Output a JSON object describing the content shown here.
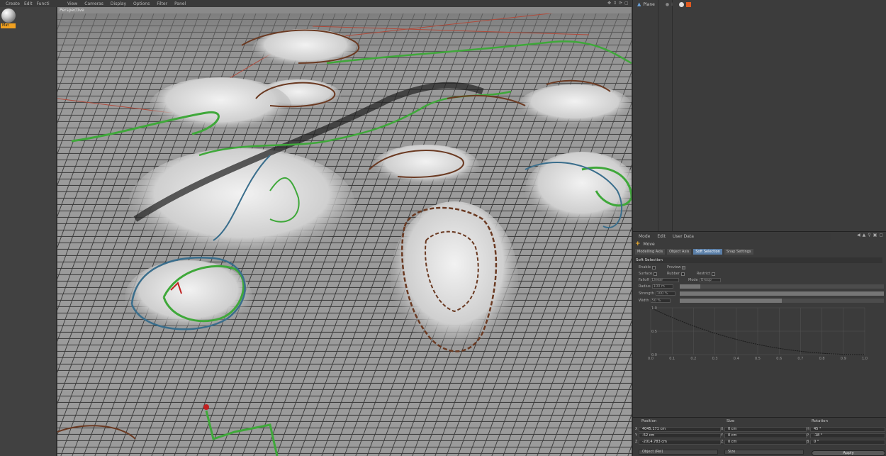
{
  "material_manager": {
    "menu": [
      "Create",
      "Edit",
      "Functi"
    ],
    "material_label": "Mat"
  },
  "viewport": {
    "menu": [
      "View",
      "Cameras",
      "Display",
      "Options",
      "Filter",
      "Panel"
    ],
    "camera_label": "Perspective"
  },
  "object_manager": {
    "object_name": "Plane"
  },
  "attribute_manager": {
    "menu": [
      "Mode",
      "Edit",
      "User Data"
    ],
    "tool_name": "Move",
    "tabs": [
      "Modelling Axis",
      "Object Axis",
      "Soft Selection",
      "Snap Settings"
    ],
    "active_tab": "Soft Selection",
    "section_title": "Soft Selection",
    "options": {
      "enable": "Enable",
      "preview": "Preview",
      "surface": "Surface",
      "rubber": "Rubber",
      "restrict": "Restrict",
      "falloff_label": "Falloff",
      "falloff_value": "Linear",
      "mode_label": "Mode",
      "mode_value": "Group",
      "radius_label": "Radius",
      "radius_value": "100 m",
      "strength_label": "Strength",
      "strength_value": "100 %",
      "width_label": "Width",
      "width_value": "50 %"
    },
    "sliders": {
      "radius": 0.1,
      "strength": 1.0,
      "width": 0.5
    },
    "curve": {
      "y_ticks": [
        "1.0",
        "0.5",
        "0.0"
      ],
      "x_ticks": [
        "0.0",
        "0.1",
        "0.2",
        "0.3",
        "0.4",
        "0.5",
        "0.6",
        "0.7",
        "0.8",
        "0.9",
        "1.0"
      ]
    }
  },
  "coordinates": {
    "headers": [
      "Position",
      "Size",
      "Rotation"
    ],
    "position": {
      "x": "4045.171 cm",
      "y": "-52 cm",
      "z": "-2014.783 cm"
    },
    "size": {
      "x": "0 cm",
      "y": "0 cm",
      "z": "0 cm"
    },
    "rotation": {
      "h": "45 °",
      "p": "-18 °",
      "b": "0 °"
    },
    "axis_labels": [
      "X",
      "Y",
      "Z"
    ],
    "rot_labels": [
      "H",
      "P",
      "B"
    ],
    "mode_dropdown": "Object (Rel)",
    "size_dropdown": "Size",
    "apply_label": "Apply"
  },
  "colors": {
    "accent_orange": "#f0a020",
    "active_tab": "#5a7fa8",
    "terrain_green": "#3fa83a",
    "terrain_brown": "#6b3a22",
    "terrain_blue": "#3a6e8c"
  }
}
